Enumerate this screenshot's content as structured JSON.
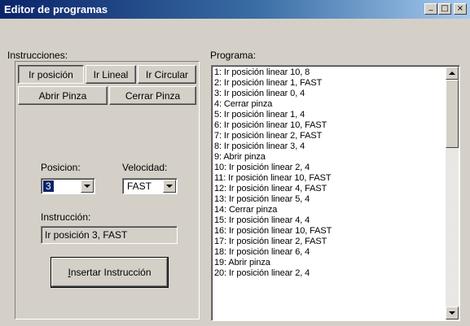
{
  "window": {
    "title": "Editor de programas",
    "controls": {
      "minimize": "_",
      "maximize": "□",
      "close": "×"
    }
  },
  "instructions": {
    "label": "Instrucciones:",
    "tabs": [
      "Ir posición",
      "Ir Lineal",
      "Ir Circular"
    ],
    "active_tab": "Ir posición",
    "buttons": {
      "open_gripper": "Abrir Pinza",
      "close_gripper": "Cerrar Pinza"
    },
    "position_label": "Posicion:",
    "position_value": "3",
    "speed_label": "Velocidad:",
    "speed_value": "FAST",
    "instruction_label": "Instrucción:",
    "instruction_value": "Ir posición 3, FAST",
    "insert_button_mnemonic": "I",
    "insert_button_rest": "nsertar Instrucción"
  },
  "program": {
    "label": "Programa:",
    "items": [
      "1: Ir posición linear 10, 8",
      "2: Ir posición linear 1, FAST",
      "3: Ir posición linear 0, 4",
      "4: Cerrar pinza",
      "5: Ir posición linear 1, 4",
      "6: Ir posición linear 10, FAST",
      "7: Ir posición linear 2, FAST",
      "8: Ir posición linear 3, 4",
      "9: Abrir pinza",
      "10: Ir posición linear 2, 4",
      "11: Ir posición linear 10, FAST",
      "12: Ir posición linear 4, FAST",
      "13: Ir posición linear 5, 4",
      "14: Cerrar pinza",
      "15: Ir posición linear 4, 4",
      "16: Ir posición linear 10, FAST",
      "17: Ir posición linear 2, FAST",
      "18: Ir posición linear 6, 4",
      "19: Abrir pinza",
      "20: Ir posición linear 2, 4"
    ]
  },
  "colors": {
    "title_bar": "#0a246a",
    "title_bar_end": "#a6caf0",
    "face": "#d4d0c8",
    "selection": "#0a246a"
  }
}
